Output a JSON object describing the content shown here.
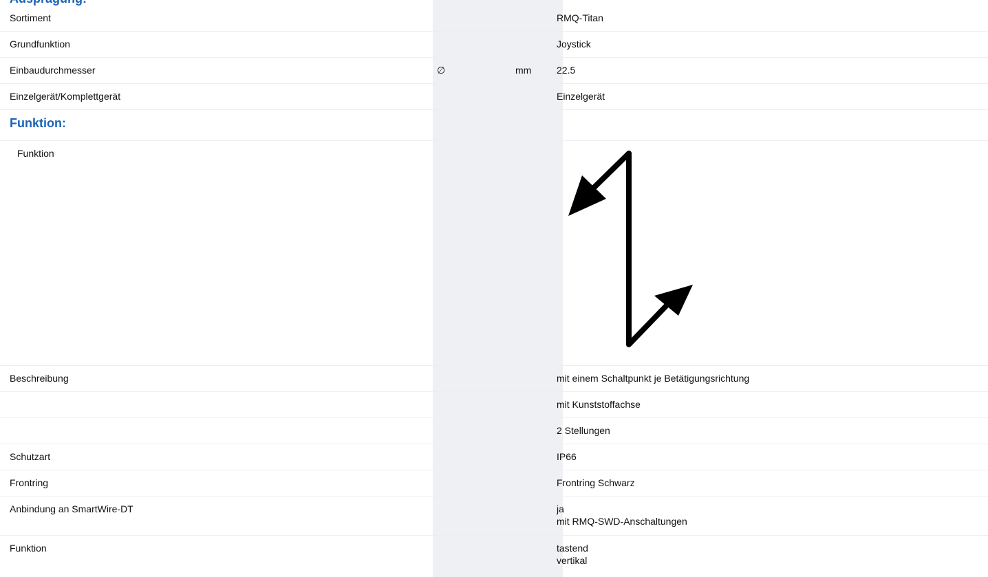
{
  "heading": "Auspragung:",
  "rows": [
    {
      "label": "Sortiment",
      "symbol": "",
      "unit": "",
      "value": [
        "RMQ-Titan"
      ]
    },
    {
      "label": "Grundfunktion",
      "symbol": "",
      "unit": "",
      "value": [
        "Joystick"
      ]
    },
    {
      "label": "Einbaudurchmesser",
      "symbol": "∅",
      "unit": "mm",
      "value": [
        "22.5"
      ]
    },
    {
      "label": "Einzelgerät/Komplettgerät",
      "symbol": "",
      "unit": "",
      "value": [
        "Einzelgerät"
      ]
    },
    {
      "label": "Funktion:",
      "section": true
    },
    {
      "label": "Funktion",
      "indent": true,
      "image": "joystick-function-arrows"
    },
    {
      "label": "Beschreibung",
      "symbol": "",
      "unit": "",
      "value": [
        "mit einem Schaltpunkt je Betätigungsrichtung"
      ]
    },
    {
      "label": "",
      "symbol": "",
      "unit": "",
      "value": [
        "mit Kunststoffachse"
      ]
    },
    {
      "label": "",
      "symbol": "",
      "unit": "",
      "value": [
        "2 Stellungen"
      ]
    },
    {
      "label": "Schutzart",
      "symbol": "",
      "unit": "",
      "value": [
        "IP66"
      ]
    },
    {
      "label": "Frontring",
      "symbol": "",
      "unit": "",
      "value": [
        "Frontring Schwarz"
      ]
    },
    {
      "label": "Anbindung an SmartWire-DT",
      "symbol": "",
      "unit": "",
      "value": [
        "ja",
        "mit RMQ-SWD-Anschaltungen"
      ]
    },
    {
      "label": "Funktion",
      "symbol": "",
      "unit": "",
      "value": [
        "tastend",
        "vertikal"
      ]
    }
  ],
  "colors": {
    "heading": "#1a63b5",
    "band": "#eef0f3",
    "divider": "#eceff2",
    "text": "#111111"
  }
}
